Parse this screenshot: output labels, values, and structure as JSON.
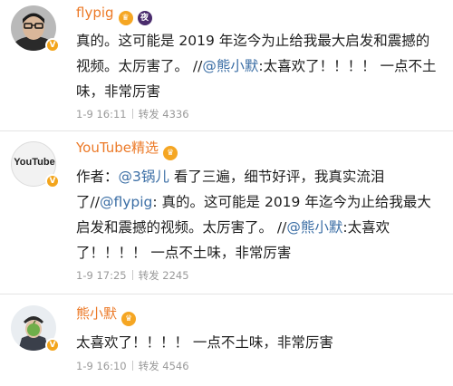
{
  "posts": [
    {
      "username": "flypig",
      "badges": [
        "crown-badge-icon",
        "rank-badge-icon"
      ],
      "segments": [
        {
          "text": "真的。这可能是 2019 年迄今为止给我最大启发和震撼的视频。太厉害了。 //"
        },
        {
          "text": "@熊小默",
          "mention": true
        },
        {
          "text": ":太喜欢了！！！！ 一点不土味，非常厉害"
        }
      ],
      "timestamp": "1-9 16:11",
      "repost_label": "转发",
      "repost_count": "4336"
    },
    {
      "username": "YouTube精选",
      "avatar_text": "YouTube",
      "badges": [
        "crown-badge-icon"
      ],
      "segments": [
        {
          "text": "作者："
        },
        {
          "text": "@3锅儿",
          "mention": true
        },
        {
          "text": " 看了三遍，细节好评，我真实流泪了//"
        },
        {
          "text": "@flypig",
          "mention": true
        },
        {
          "text": ": 真的。这可能是 2019 年迄今为止给我最大启发和震撼的视频。太厉害了。 //"
        },
        {
          "text": "@熊小默",
          "mention": true
        },
        {
          "text": ":太喜欢了！！！！ 一点不土味，非常厉害"
        }
      ],
      "timestamp": "1-9 17:25",
      "repost_label": "转发",
      "repost_count": "2245"
    },
    {
      "username": "熊小默",
      "badges": [
        "crown-badge-icon"
      ],
      "segments": [
        {
          "text": "太喜欢了！！！！ 一点不土味，非常厉害"
        }
      ],
      "timestamp": "1-9 16:10",
      "repost_label": "转发",
      "repost_count": "4546"
    }
  ],
  "colors": {
    "username": "#ec7a28",
    "mention": "#3b6ea5",
    "meta": "#9a9a9a",
    "verified": "#f3a51c"
  }
}
